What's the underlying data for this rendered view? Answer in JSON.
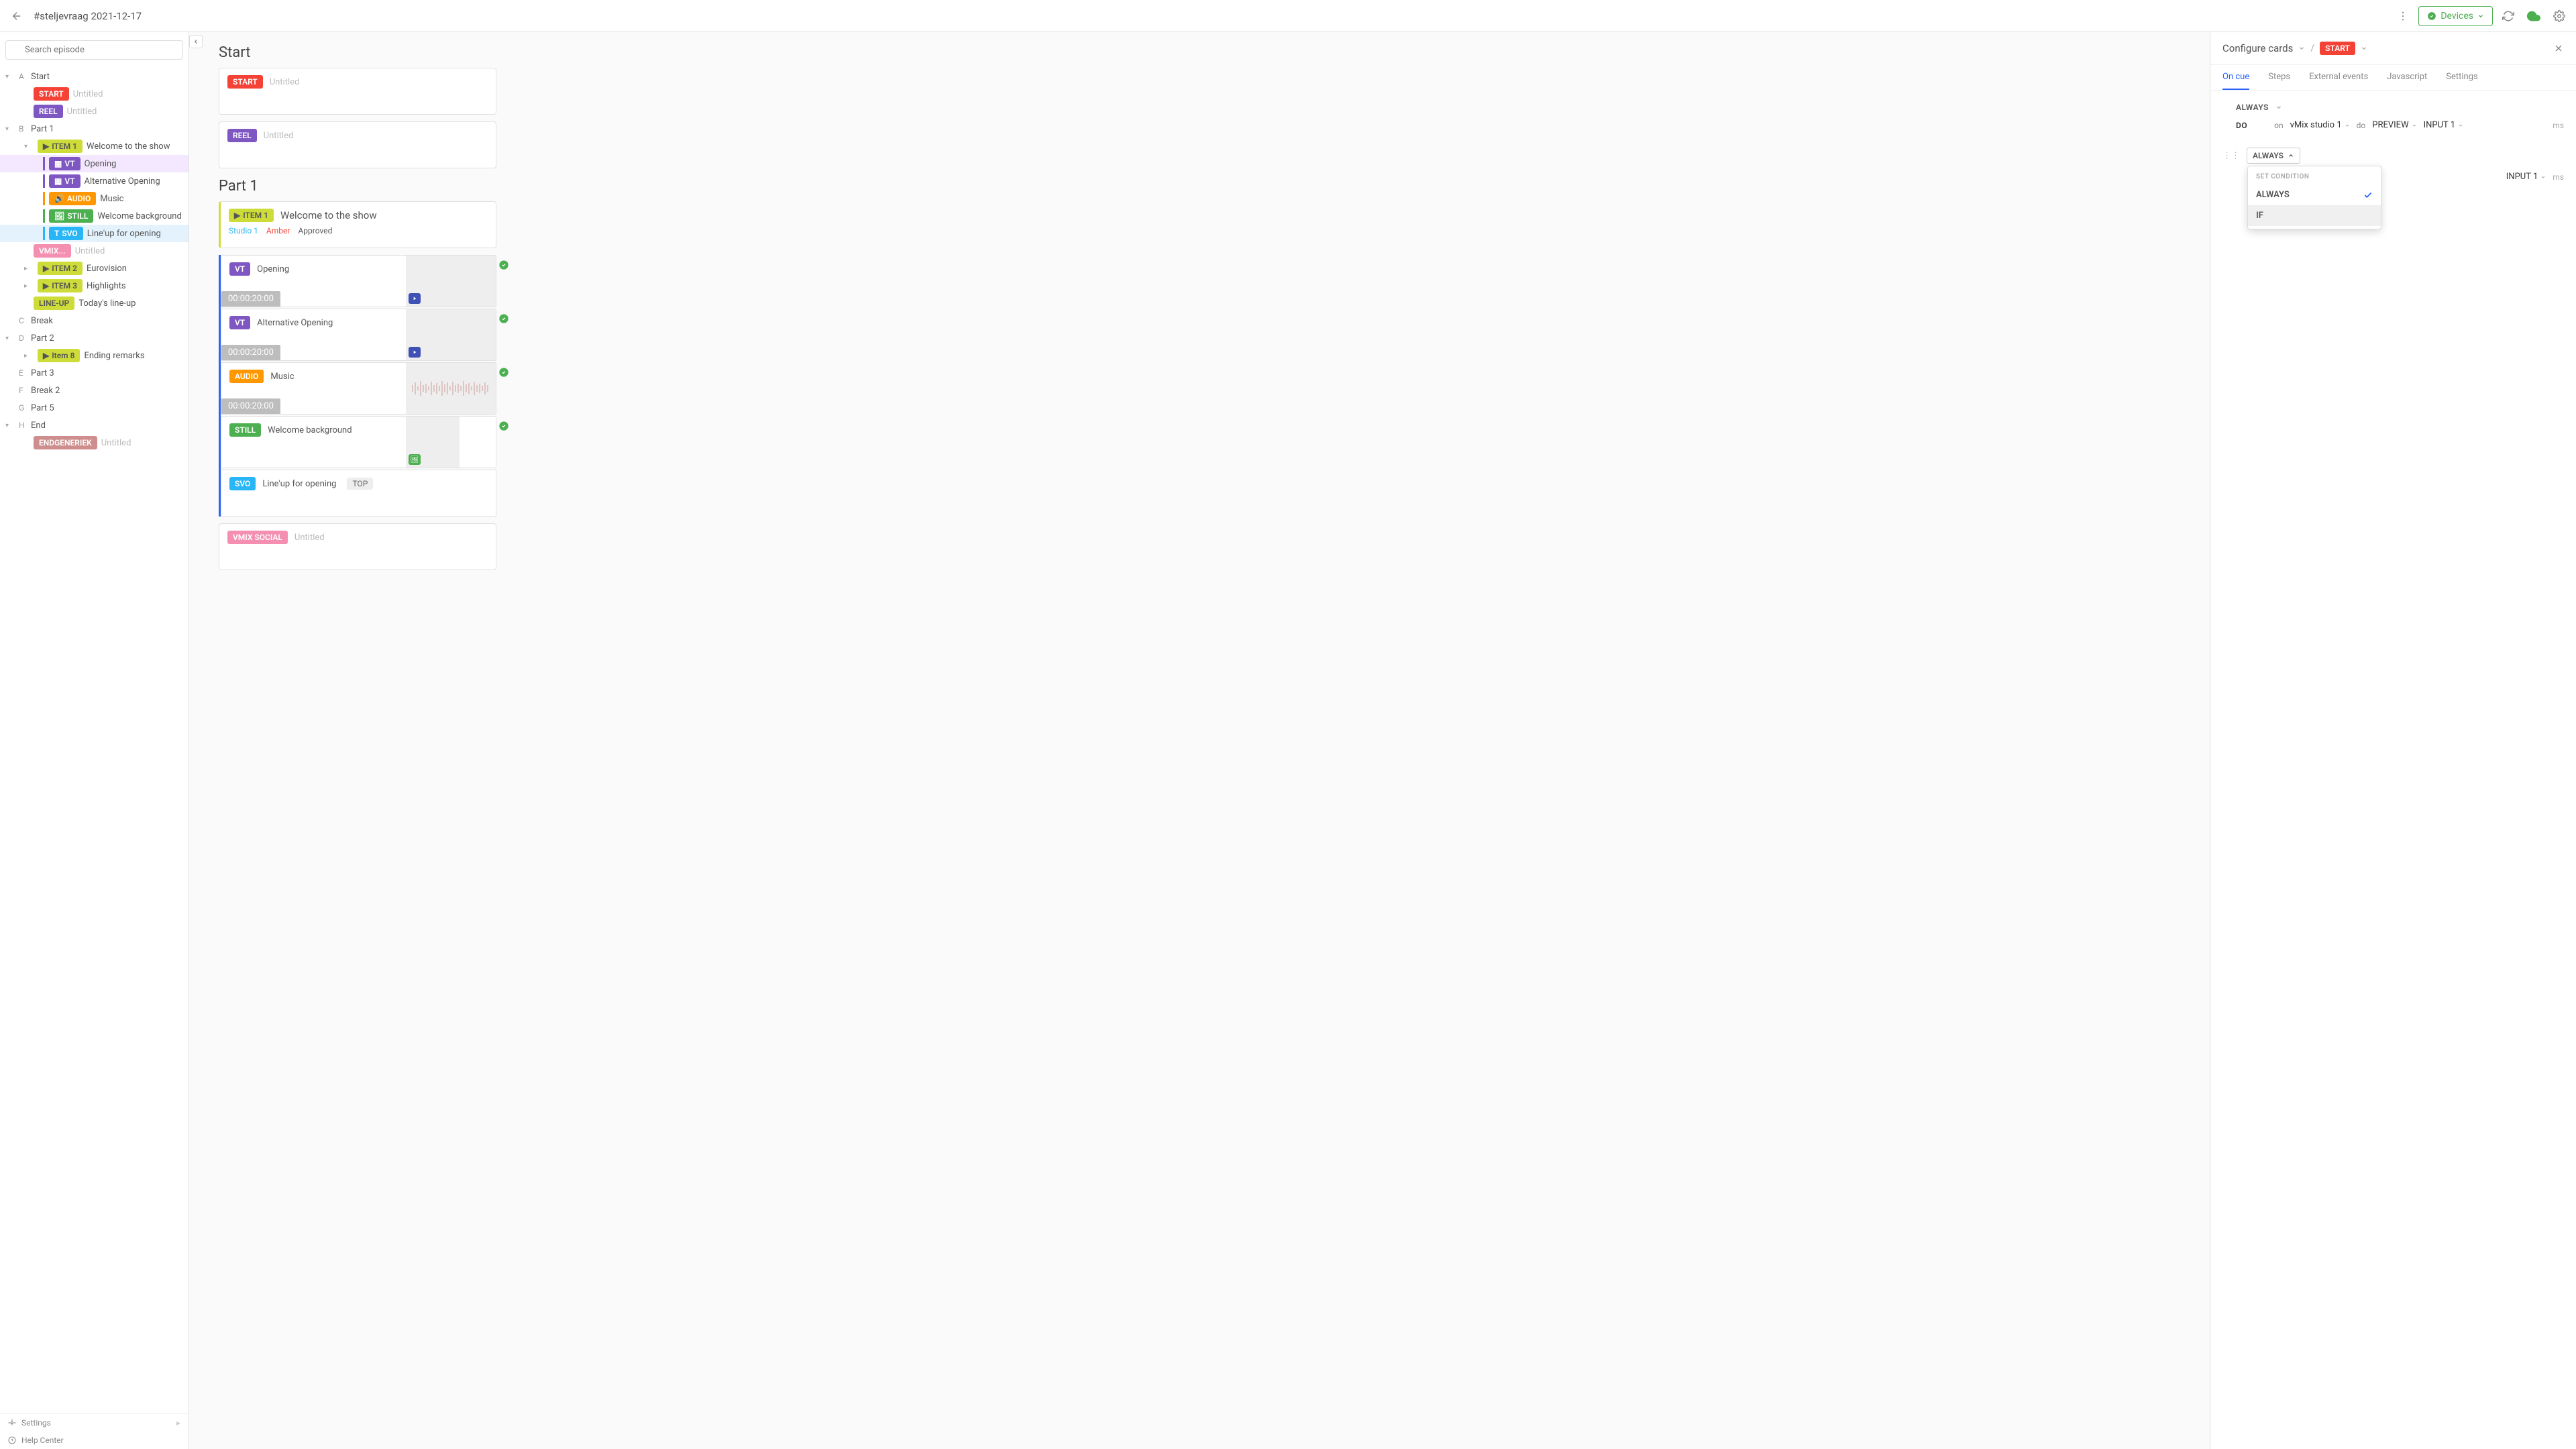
{
  "topbar": {
    "title": "#steljevraag 2021-12-17",
    "devices": "Devices"
  },
  "sidebar": {
    "search_placeholder": "Search episode",
    "settings": "Settings",
    "help": "Help Center",
    "sections": {
      "a": {
        "letter": "A",
        "label": "Start"
      },
      "b": {
        "letter": "B",
        "label": "Part 1"
      },
      "c": {
        "letter": "C",
        "label": "Break"
      },
      "d": {
        "letter": "D",
        "label": "Part 2"
      },
      "e": {
        "letter": "E",
        "label": "Part 3"
      },
      "f": {
        "letter": "F",
        "label": "Break 2"
      },
      "g": {
        "letter": "G",
        "label": "Part 5"
      },
      "h": {
        "letter": "H",
        "label": "End"
      }
    },
    "start_children": {
      "start": {
        "tag": "START",
        "label": "Untitled"
      },
      "reel": {
        "tag": "REEL",
        "label": "Untitled"
      }
    },
    "item1": {
      "tag": "ITEM 1",
      "label": "Welcome to the show"
    },
    "item1_children": {
      "vt1": {
        "tag": "VT",
        "label": "Opening"
      },
      "vt2": {
        "tag": "VT",
        "label": "Alternative Opening"
      },
      "audio": {
        "tag": "AUDIO",
        "label": "Music"
      },
      "still": {
        "tag": "STILL",
        "label": "Welcome background"
      },
      "svo": {
        "tag": "SVO",
        "label": "Line'up for opening"
      },
      "vmix": {
        "tag": "VMIX...",
        "label": "Untitled"
      }
    },
    "item2": {
      "tag": "ITEM 2",
      "label": "Eurovision"
    },
    "item3": {
      "tag": "ITEM 3",
      "label": "Highlights"
    },
    "lineup": {
      "tag": "LINE-UP",
      "label": "Today's line-up"
    },
    "item8": {
      "tag": "Item 8",
      "label": "Ending remarks"
    },
    "endgen": {
      "tag": "ENDGENERIEK",
      "label": "Untitled"
    }
  },
  "center": {
    "start_title": "Start",
    "start_card": {
      "tag": "START",
      "label": "Untitled"
    },
    "reel_card": {
      "tag": "REEL",
      "label": "Untitled"
    },
    "part1_title": "Part 1",
    "item1_card": {
      "tag": "ITEM 1",
      "label": "Welcome to the show",
      "tag1": "Studio 1",
      "tag2": "Amber",
      "tag3": "Approved"
    },
    "media": {
      "vt1": {
        "tag": "VT",
        "label": "Opening",
        "tc": "00:00:20:00"
      },
      "vt2": {
        "tag": "VT",
        "label": "Alternative Opening",
        "tc": "00:00:20:00"
      },
      "audio": {
        "tag": "AUDIO",
        "label": "Music",
        "tc": "00:00:20:00"
      },
      "still": {
        "tag": "STILL",
        "label": "Welcome background"
      },
      "svo": {
        "tag": "SVO",
        "label": "Line'up for opening",
        "badge": "TOP"
      },
      "vmixsocial": {
        "tag": "VMIX SOCIAL",
        "label": "Untitled"
      }
    }
  },
  "rightpanel": {
    "title": "Configure cards",
    "start_tag": "START",
    "tabs": {
      "oncue": "On cue",
      "steps": "Steps",
      "external": "External events",
      "js": "Javascript",
      "settings": "Settings"
    },
    "rule1": {
      "condition": "ALWAYS",
      "do": "DO",
      "on": "on",
      "on_val": "vMix studio 1",
      "do2": "do",
      "do_val": "PREVIEW",
      "input": "INPUT 1",
      "ms": "ms"
    },
    "rule2": {
      "condition": "ALWAYS",
      "input": "INPUT 1",
      "ms": "ms"
    },
    "dropdown": {
      "label": "SET CONDITION",
      "opt1": "ALWAYS",
      "opt2": "IF"
    }
  }
}
